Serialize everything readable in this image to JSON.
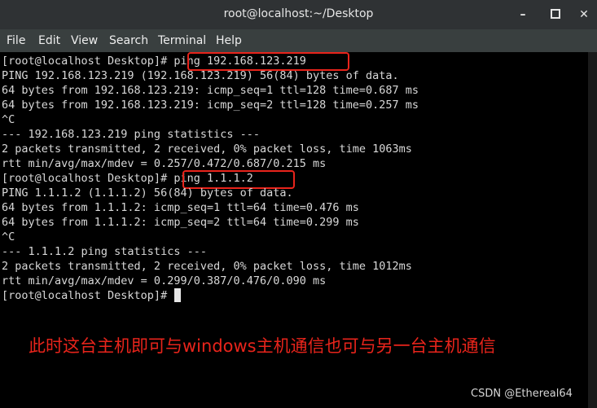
{
  "window": {
    "title": "root@localhost:~/Desktop",
    "minimize_glyph": "–",
    "close_glyph": "✕"
  },
  "menu": [
    {
      "label": "File"
    },
    {
      "label": "Edit"
    },
    {
      "label": "View"
    },
    {
      "label": "Search"
    },
    {
      "label": "Terminal"
    },
    {
      "label": "Help"
    }
  ],
  "terminal": {
    "prompt": "[root@localhost Desktop]# ",
    "command_1": "ping 192.168.123.219",
    "lines_1": [
      "PING 192.168.123.219 (192.168.123.219) 56(84) bytes of data.",
      "64 bytes from 192.168.123.219: icmp_seq=1 ttl=128 time=0.687 ms",
      "64 bytes from 192.168.123.219: icmp_seq=2 ttl=128 time=0.257 ms",
      "^C",
      "--- 192.168.123.219 ping statistics ---",
      "2 packets transmitted, 2 received, 0% packet loss, time 1063ms",
      "rtt min/avg/max/mdev = 0.257/0.472/0.687/0.215 ms"
    ],
    "command_2": "ping 1.1.1.2",
    "lines_2": [
      "PING 1.1.1.2 (1.1.1.2) 56(84) bytes of data.",
      "64 bytes from 1.1.1.2: icmp_seq=1 ttl=64 time=0.476 ms",
      "64 bytes from 1.1.1.2: icmp_seq=2 ttl=64 time=0.299 ms",
      "^C",
      "--- 1.1.1.2 ping statistics ---",
      "2 packets transmitted, 2 received, 0% packet loss, time 1012ms",
      "rtt min/avg/max/mdev = 0.299/0.387/0.476/0.090 ms"
    ]
  },
  "annotation": "此时这台主机即可与windows主机通信也可与另一台主机通信",
  "watermark": "CSDN @Ethereal64",
  "colors": {
    "highlight": "#e8241b",
    "terminal_bg": "#000000",
    "terminal_fg": "#d8d8d8"
  }
}
